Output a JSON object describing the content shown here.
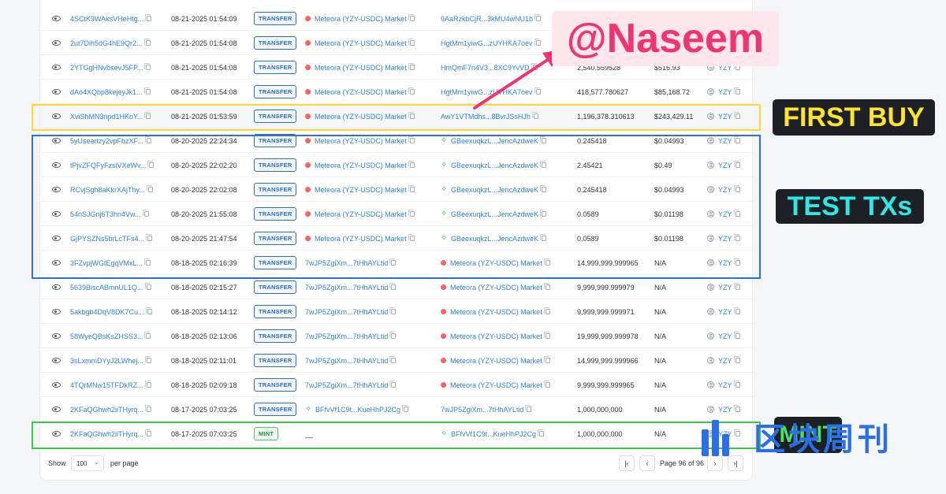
{
  "rows": [
    {
      "sig": "4SCtK9WAksVHeHtg...",
      "time": "08-21-2025 01:54:09",
      "type": "TRANSFER",
      "from": "Meteora (YZY-USDC) Market",
      "from_icon": "meteora",
      "to": "9AaRzkbCjR...3kMU4wNU1b",
      "to_icon": "",
      "amount": "",
      "value": "",
      "token": ""
    },
    {
      "sig": "2ut7Dih5dG4hE9Qr2...",
      "time": "08-21-2025 01:54:08",
      "type": "TRANSFER",
      "from": "Meteora (YZY-USDC) Market",
      "from_icon": "meteora",
      "to": "HgtMm1yiwG...zUYHKA7oev",
      "to_icon": "",
      "amount": "",
      "value": "",
      "token": ""
    },
    {
      "sig": "2YTGgHNvbsevJ5FP...",
      "time": "08-21-2025 01:54:08",
      "type": "TRANSFER",
      "from": "Meteora (YZY-USDC) Market",
      "from_icon": "meteora",
      "to": "HmQmF7n4V3...8XC9YvVD",
      "to_icon": "",
      "amount": "2,540.559528",
      "value": "$516.93",
      "token": "YZY"
    },
    {
      "sig": "dAo4XQbp8kejeyJk1...",
      "time": "08-21-2025 01:54:08",
      "type": "TRANSFER",
      "from": "Meteora (YZY-USDC) Market",
      "from_icon": "meteora",
      "to": "HgtMm1yiwG...zUYHKA7oev",
      "to_icon": "",
      "amount": "418,577.780627",
      "value": "$85,168.72",
      "token": "YZY"
    },
    {
      "sig": "XviShMN3npd1HKoY...",
      "time": "08-21-2025 01:53:59",
      "type": "TRANSFER",
      "from": "Meteora (YZY-USDC) Market",
      "from_icon": "meteora",
      "to": "AwY1VTMdhs...8BvrJSsHJh",
      "to_icon": "",
      "amount": "1,196,378.310613",
      "value": "$243,429.11",
      "token": "YZY",
      "highlight": true
    },
    {
      "sig": "5yUseartzy2vpFbzXF...",
      "time": "08-20-2025 22:24:34",
      "type": "TRANSFER",
      "from": "Meteora (YZY-USDC) Market",
      "from_icon": "meteora",
      "to": "GBeexuqkzL...JencAzdweK",
      "to_icon": "star",
      "amount": "0.245418",
      "value": "$0.04993",
      "token": "YZY"
    },
    {
      "sig": "tPjvZFQFyFzsiVXeWv...",
      "time": "08-20-2025 22:02:20",
      "type": "TRANSFER",
      "from": "Meteora (YZY-USDC) Market",
      "from_icon": "meteora",
      "to": "GBeexuqkzL...JencAzdweK",
      "to_icon": "star",
      "amount": "2.45421",
      "value": "$0.49",
      "token": "YZY"
    },
    {
      "sig": "RCvjSgh8aKkrXAjThy...",
      "time": "08-20-2025 22:02:08",
      "type": "TRANSFER",
      "from": "Meteora (YZY-USDC) Market",
      "from_icon": "meteora",
      "to": "GBeexuqkzL...JencAzdweK",
      "to_icon": "star",
      "amount": "0.245418",
      "value": "$0.04993",
      "token": "YZY"
    },
    {
      "sig": "54nSJGnj6T3hn4Vw...",
      "time": "08-20-2025 21:55:08",
      "type": "TRANSFER",
      "from": "Meteora (YZY-USDC) Market",
      "from_icon": "meteora",
      "to": "GBeexuqkzL...JencAzdweK",
      "to_icon": "star",
      "amount": "0.0589",
      "value": "$0.01198",
      "token": "YZY"
    },
    {
      "sig": "GjPYSZNs5brLcTFs4...",
      "time": "08-20-2025 21:47:54",
      "type": "TRANSFER",
      "from": "Meteora (YZY-USDC) Market",
      "from_icon": "meteora",
      "to": "GBeexuqkzL...JencAzdweK",
      "to_icon": "star",
      "amount": "0.0589",
      "value": "$0.01198",
      "token": "YZY"
    },
    {
      "sig": "3FZvpjWGtEgqVMxL...",
      "time": "08-18-2025 02:16:39",
      "type": "TRANSFER",
      "from": "7wJP5ZgiXm...7tHhAYLtid",
      "from_icon": "",
      "to": "Meteora (YZY-USDC) Market",
      "to_icon": "meteora",
      "amount": "14,999,999.999965",
      "value": "N/A",
      "token": "YZY"
    },
    {
      "sig": "5639BiscABmnUL1Q...",
      "time": "08-18-2025 02:15:27",
      "type": "TRANSFER",
      "from": "7wJP5ZgiXm...7tHhAYLtid",
      "from_icon": "",
      "to": "Meteora (YZY-USDC) Market",
      "to_icon": "meteora",
      "amount": "9,999,999.999979",
      "value": "N/A",
      "token": "YZY"
    },
    {
      "sig": "5akbgb4DqV8DK7Cu...",
      "time": "08-18-2025 02:14:12",
      "type": "TRANSFER",
      "from": "7wJP5ZgiXm...7tHhAYLtid",
      "from_icon": "",
      "to": "Meteora (YZY-USDC) Market",
      "to_icon": "meteora",
      "amount": "9,999,999.999971",
      "value": "N/A",
      "token": "YZY"
    },
    {
      "sig": "58WyeQBsKsZHSS3...",
      "time": "08-18-2025 02:13:06",
      "type": "TRANSFER",
      "from": "7wJP5ZgiXm...7tHhAYLtid",
      "from_icon": "",
      "to": "Meteora (YZY-USDC) Market",
      "to_icon": "meteora",
      "amount": "19,999,999.999978",
      "value": "N/A",
      "token": "YZY"
    },
    {
      "sig": "3sLxmmDYyJ2LWhej...",
      "time": "08-18-2025 02:11:01",
      "type": "TRANSFER",
      "from": "7wJP5ZgiXm...7tHhAYLtid",
      "from_icon": "",
      "to": "Meteora (YZY-USDC) Market",
      "to_icon": "meteora",
      "amount": "14,999,999.999966",
      "value": "N/A",
      "token": "YZY"
    },
    {
      "sig": "4TQrMNw15TFDkRZ...",
      "time": "08-18-2025 02:09:18",
      "type": "TRANSFER",
      "from": "7wJP5ZgiXm...7tHhAYLtid",
      "from_icon": "",
      "to": "Meteora (YZY-USDC) Market",
      "to_icon": "meteora",
      "amount": "9,999,999.999965",
      "value": "N/A",
      "token": "YZY"
    },
    {
      "sig": "2KFaQGhwh2iiTHyrq...",
      "time": "08-17-2025 07:03:25",
      "type": "TRANSFER",
      "from": "BFfvVf1C9t...KueHhPJ2Cg",
      "from_icon": "star",
      "to": "7wJP5ZgiXm...7tHhAYLtid",
      "to_icon": "",
      "amount": "1,000,000,000",
      "value": "N/A",
      "token": "YZY"
    },
    {
      "sig": "2KFaQGhwh2iiTHyrq...",
      "time": "08-17-2025 07:03:25",
      "type": "MINT",
      "from": "__",
      "from_icon": "dash",
      "to": "BFfvVf1C9t...KueHhPJ2Cg",
      "to_icon": "star",
      "amount": "1,000,000,000",
      "value": "N/A",
      "token": "YZY"
    }
  ],
  "footer": {
    "show_label": "Show",
    "per_page_value": "100",
    "per_page_label": "per page",
    "page_info": "Page 96 of 96",
    "first": "|‹",
    "prev": "‹",
    "next": "›",
    "last": "›|"
  },
  "annotations": {
    "naseem": "@Naseem",
    "first_buy": "FIRST BUY",
    "test_txs": "TEST TXs",
    "mint": "MINT",
    "watermark": "区块周刊",
    "colors": {
      "first_buy": "#fdd835",
      "test_txs": "#2f6fd8",
      "mint": "#3cc64b",
      "arrow": "#f0346f"
    }
  }
}
